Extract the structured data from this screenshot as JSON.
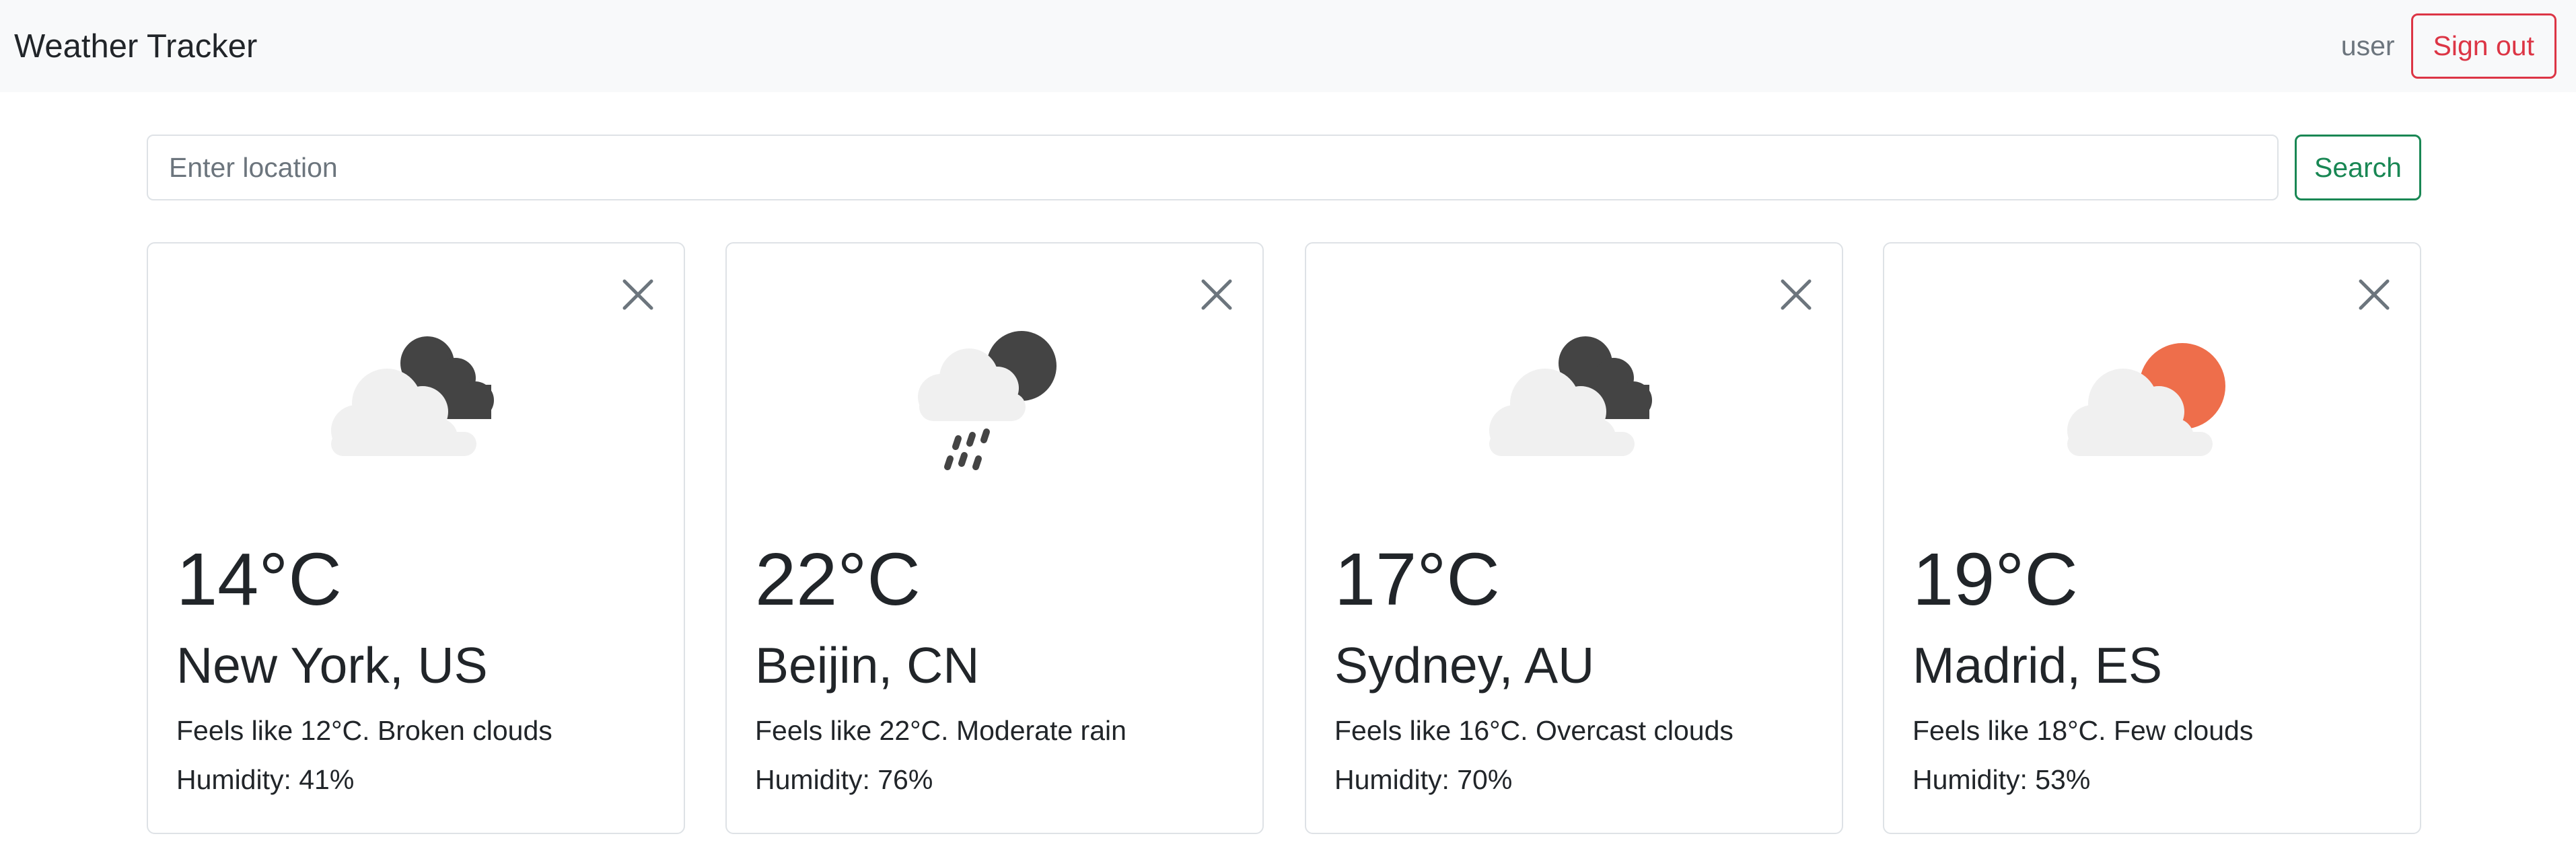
{
  "app": {
    "brand": "Weather Tracker",
    "username": "user",
    "signout_label": "Sign out"
  },
  "search": {
    "placeholder": "Enter location",
    "value": "",
    "button_label": "Search"
  },
  "colors": {
    "danger": "#dc3545",
    "success": "#198754",
    "cloud_light": "#f0f0f0",
    "cloud_dark": "#444444",
    "sun": "#ee6e4b"
  },
  "cards": [
    {
      "temp": "14°C",
      "city": "New York, US",
      "desc": "Feels like 12°C. Broken clouds",
      "humidity": "Humidity: 41%",
      "icon": "broken-clouds-icon"
    },
    {
      "temp": "22°C",
      "city": "Beijin, CN",
      "desc": "Feels like 22°C. Moderate rain",
      "humidity": "Humidity: 76%",
      "icon": "rain-moon-icon"
    },
    {
      "temp": "17°C",
      "city": "Sydney, AU",
      "desc": "Feels like 16°C. Overcast clouds",
      "humidity": "Humidity: 70%",
      "icon": "overcast-clouds-icon"
    },
    {
      "temp": "19°C",
      "city": "Madrid, ES",
      "desc": "Feels like 18°C. Few clouds",
      "humidity": "Humidity: 53%",
      "icon": "few-clouds-sun-icon"
    }
  ]
}
